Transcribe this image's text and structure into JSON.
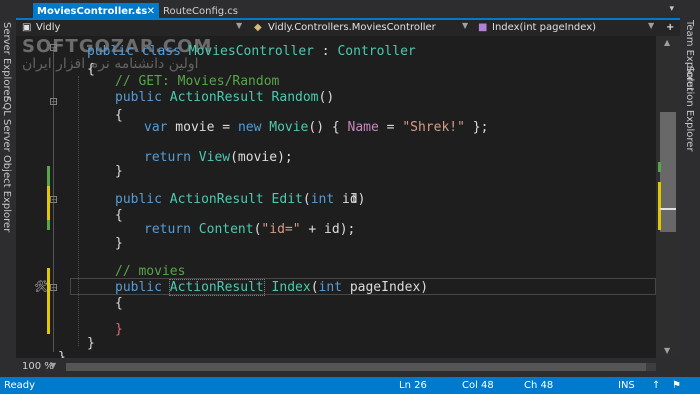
{
  "tabs": [
    {
      "label": "MoviesController.cs",
      "active": true
    },
    {
      "label": "RouteConfig.cs",
      "active": false
    }
  ],
  "navbar": {
    "project": "Vidly",
    "class_path": "Vidly.Controllers.MoviesController",
    "member": "Index(int pageIndex)"
  },
  "left_toolwindows": [
    "Server Explorer",
    "SQL Server Object Explorer"
  ],
  "right_toolwindows": [
    "Team Explorer",
    "Solution Explorer"
  ],
  "watermark": {
    "en": "SOFTGOZAR.COM",
    "fa": "اولین دانشنامه نرم افزار ایران"
  },
  "code": {
    "l1": {
      "kw": "public class",
      "type": "MoviesController",
      "sep": " : ",
      "base": "Controller"
    },
    "l2": "{",
    "l3": "// GET: Movies/Random",
    "l4": {
      "kw": "public",
      "type": "ActionResult",
      "name": "Random",
      "args": "()"
    },
    "l5": "{",
    "l6": {
      "kw1": "var",
      "var": " movie = ",
      "kw2": "new",
      "type": "Movie",
      "rest1": "() { ",
      "prop": "Name",
      "rest2": " = ",
      "str": "\"Shrek!\"",
      "rest3": " };"
    },
    "l7": {
      "kw": "return",
      "call": "View",
      "rest": "(movie);"
    },
    "l8": "}",
    "l9": {
      "kw": "public",
      "type": "ActionResult",
      "name": "Edit",
      "open": "(",
      "kw2": "int",
      "rest": " id)"
    },
    "l10": "{",
    "l11": {
      "kw": "return",
      "call": "Content",
      "open": "(",
      "str": "\"id=\"",
      "rest": " + id);"
    },
    "l12": "}",
    "l13": "// movies",
    "l14": {
      "kw": "public",
      "type": "ActionResult",
      "name": "Index",
      "open": "(",
      "kw2": "int",
      "rest": " pageIndex)"
    },
    "l15": "{",
    "l16": "}",
    "l17": "}",
    "l18": "}"
  },
  "zoom": "100 %",
  "status": {
    "ready": "Ready",
    "ln": "Ln 26",
    "col": "Col 48",
    "ch": "Ch 48",
    "ins": "INS"
  },
  "colors": {
    "accent": "#007acc",
    "editor_bg": "#1e1e1e",
    "keyword": "#569cd6",
    "type": "#4ec9b0",
    "comment": "#57a64a",
    "string": "#d69d85"
  }
}
